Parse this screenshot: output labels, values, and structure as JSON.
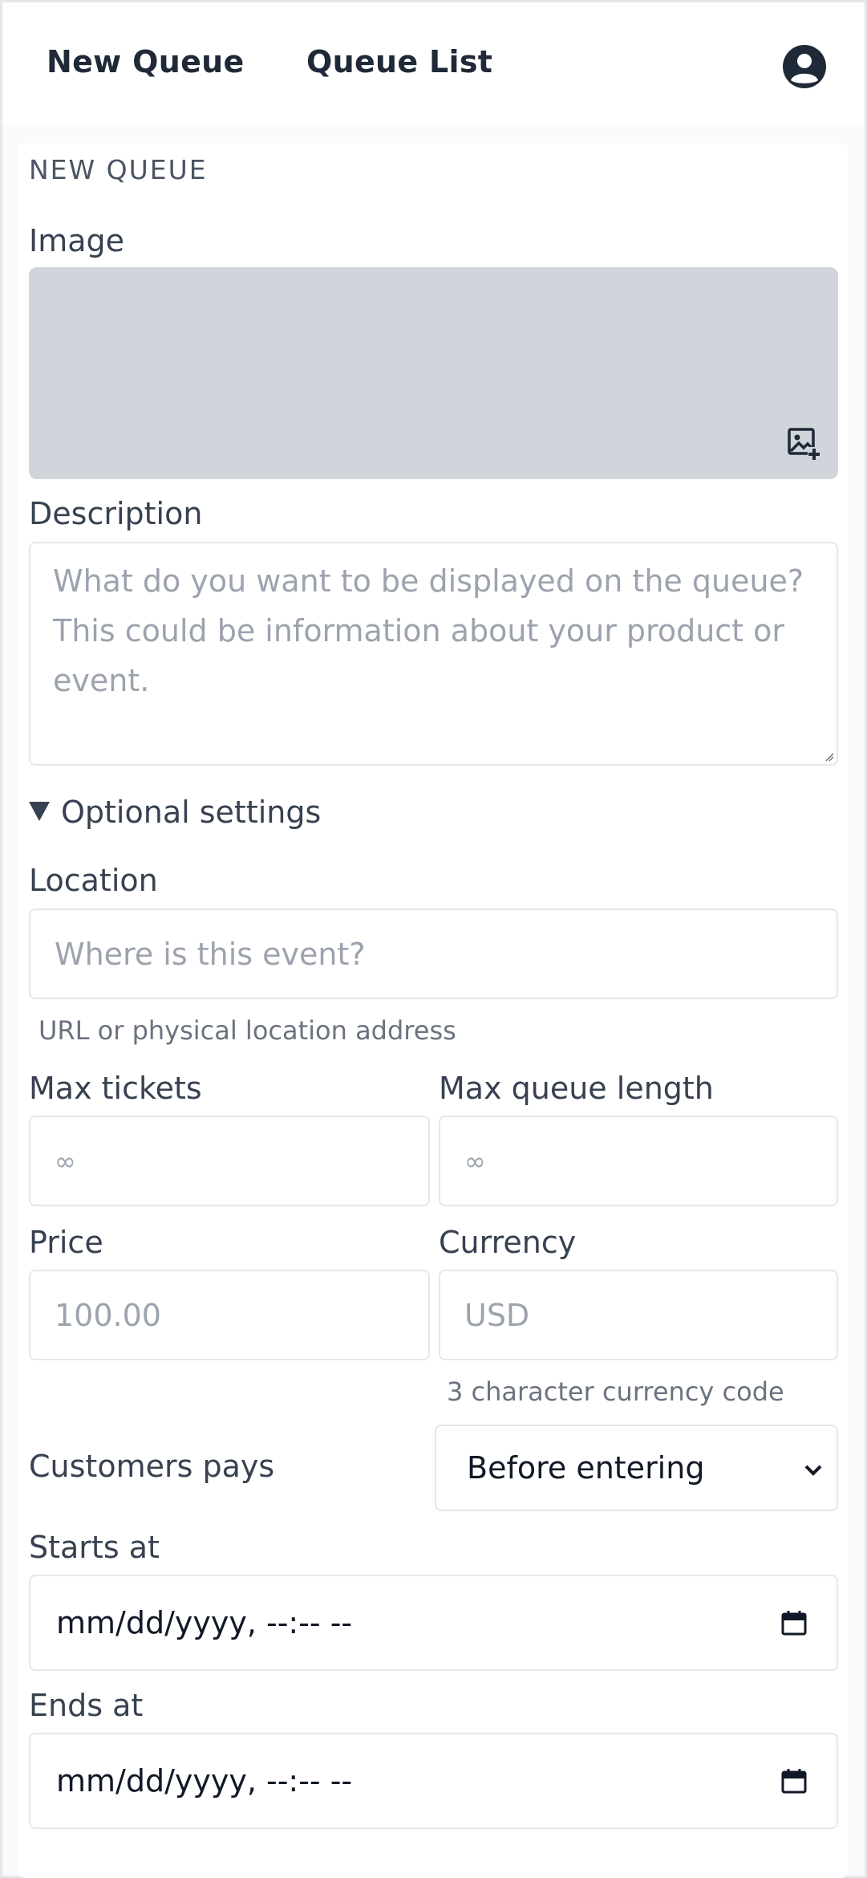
{
  "nav": {
    "new_queue": "New Queue",
    "queue_list": "Queue List",
    "avatar_icon": "user-circle-icon"
  },
  "form": {
    "section_title": "NEW QUEUE",
    "image_label": "Image",
    "image_icon": "image-add-icon",
    "description_label": "Description",
    "description_placeholder": "What do you want to be displayed on the queue? This could be information about your product or event.",
    "optional_settings": "Optional settings",
    "location_label": "Location",
    "location_placeholder": "Where is this event?",
    "location_hint": "URL or physical location address",
    "max_tickets_label": "Max tickets",
    "max_tickets_placeholder": "∞",
    "max_queue_length_label": "Max queue length",
    "max_queue_length_placeholder": "∞",
    "price_label": "Price",
    "price_placeholder": "100.00",
    "currency_label": "Currency",
    "currency_placeholder": "USD",
    "currency_hint": "3 character currency code",
    "customers_pays_label": "Customers pays",
    "customers_pays_value": "Before entering",
    "starts_at_label": "Starts at",
    "starts_at_value": "mm/dd/yyyy, --:-- --",
    "ends_at_label": "Ends at",
    "ends_at_value": "mm/dd/yyyy, --:-- --"
  },
  "colors": {
    "text": "#374151",
    "nav_text": "#1f2937",
    "placeholder": "#9ca3af",
    "image_bg": "#d1d5db",
    "border": "#e5e7eb"
  }
}
